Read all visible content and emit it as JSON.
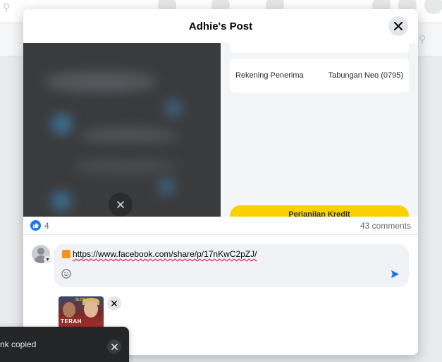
{
  "modal": {
    "title": "Adhie's Post"
  },
  "post": {
    "info_label": "Rekening Penerima",
    "info_value": "Tabungan Neo (0795)",
    "button_label": "Perjanjian Kredit"
  },
  "reactions": {
    "like_count": "4",
    "comments": "43 comments"
  },
  "composer": {
    "text": "https://www.facebook.com/share/p/17nKwC2pZJ/"
  },
  "attachment": {
    "label": "TERAH",
    "logo": "SLOT"
  },
  "toast": {
    "message": "nk copied"
  },
  "colors": {
    "accent": "#1877f2",
    "yellow": "#f9d100",
    "toast_bg": "#242526"
  }
}
